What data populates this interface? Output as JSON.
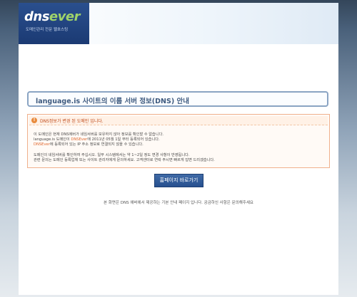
{
  "header": {
    "logo_text_prefix": "dns",
    "logo_text_suffix": "ever",
    "logo_tagline": "도메인관리 전문 웹호스팅"
  },
  "title": {
    "text": "language.is 사이트의 이름 서버 정보(DNS) 안내"
  },
  "notice": {
    "title": "DNS정보가 변경 된 도메인 입니다.",
    "lines": [
      {
        "a": "이 도메인은 현재 DNS에버가 네임서버를 보유하지 않아 정보를 확인할 수 없습니다.",
        "b": "",
        "c": ""
      },
      {
        "a": "language.is 도메인이 ",
        "b": "DNSEver",
        "c": "에 2011년 05월 1일 부터 등록되어 있습니다."
      },
      {
        "a": "",
        "b": "DNSEver",
        "c": "에 등록되어 있는 IP 주소 정보로 연결되지 않을 수 있습니다."
      },
      {
        "a": "도메인의 네임서버를 확인하여 주십시오. 일부 시스템에서는 약 1~2일 정도 변경 사항이 반영됩니다.",
        "b": "",
        "c": ""
      },
      {
        "a": "관련 문의는 도메인 등록업체 또는 사이트 관리자에게 문의하세요. 고객센터로 연락 주시면 빠르게 답변 드리겠습니다.",
        "b": "",
        "c": ""
      }
    ]
  },
  "button": {
    "label": "홈페이지 바로가기"
  },
  "footer": {
    "text": "본 화면은 DNS 에버에서 제공하는 기본 안내 페이지 입니다. 궁금하신 사항은 문의해주세요"
  },
  "colors": {
    "logo_bg": "#1b3a73",
    "accent_green": "#9fd36a",
    "title_text": "#3e5a7f",
    "notice_border": "#f0b08c",
    "highlight": "#e0672d",
    "button_bg": "#27508f"
  }
}
